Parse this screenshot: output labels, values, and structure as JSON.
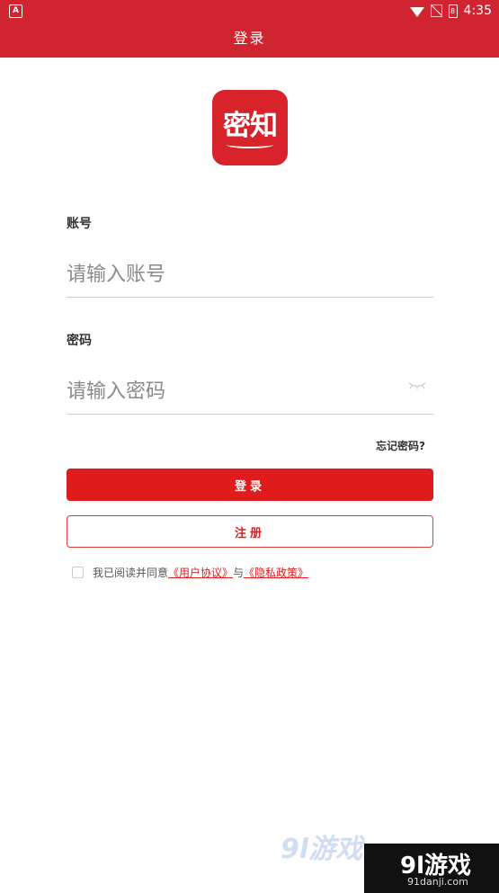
{
  "status_bar": {
    "left_icon": "A",
    "time": "4:35",
    "battery": "8"
  },
  "title": "登录",
  "logo_text": "密知",
  "account": {
    "label": "账号",
    "placeholder": "请输入账号"
  },
  "password": {
    "label": "密码",
    "placeholder": "请输入密码"
  },
  "forgot_label": "忘记密码?",
  "login_label": "登录",
  "register_label": "注册",
  "agreement": {
    "prefix": "我已阅读并同意",
    "user_agreement": "《用户协议》",
    "joiner": "与",
    "privacy_policy": "《隐私政策》"
  },
  "watermark": {
    "logo": "9l游戏",
    "url": "91danji.com"
  },
  "colors": {
    "brand_red": "#d02530",
    "button_red": "#e01b1b"
  }
}
